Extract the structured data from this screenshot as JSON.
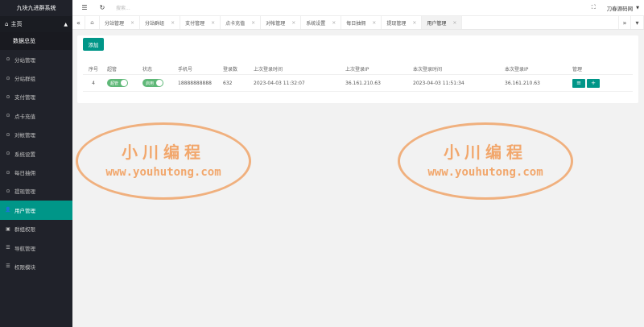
{
  "app_title": "九块九进群系统",
  "sidebar": {
    "home_label": "主页",
    "home_sub": "数据总览",
    "items": [
      {
        "label": "分站管理",
        "icon": "circle-check-icon"
      },
      {
        "label": "分站群组",
        "icon": "circle-check-icon"
      },
      {
        "label": "支付管理",
        "icon": "circle-check-icon"
      },
      {
        "label": "点卡充值",
        "icon": "circle-check-icon"
      },
      {
        "label": "对帐管理",
        "icon": "circle-check-icon"
      },
      {
        "label": "系统设置",
        "icon": "circle-check-icon"
      },
      {
        "label": "每日抽佣",
        "icon": "circle-check-icon"
      },
      {
        "label": "提现管理",
        "icon": "circle-check-icon"
      },
      {
        "label": "用户管理",
        "icon": "user-icon",
        "active": true
      },
      {
        "label": "群组权限",
        "icon": "group-icon"
      },
      {
        "label": "导航管理",
        "icon": "list-icon"
      },
      {
        "label": "权限模块",
        "icon": "list-icon"
      }
    ]
  },
  "topbar": {
    "search_placeholder": "搜索...",
    "username": "刀春源码网"
  },
  "tabs": [
    {
      "label": "分站管理"
    },
    {
      "label": "分站群组"
    },
    {
      "label": "支付管理"
    },
    {
      "label": "点卡充值"
    },
    {
      "label": "对帐管理"
    },
    {
      "label": "系统设置"
    },
    {
      "label": "每日抽佣"
    },
    {
      "label": "提现管理"
    },
    {
      "label": "用户管理",
      "active": true
    }
  ],
  "main": {
    "add_label": "添加",
    "columns": [
      "序号",
      "超管",
      "状态",
      "手机号",
      "登录数",
      "上次登录时间",
      "上次登录IP",
      "本次登录时间",
      "本次登录IP",
      "管理"
    ],
    "rows": [
      {
        "index": "4",
        "admin_switch": "超管",
        "status_switch": "启用",
        "phone": "18888888888",
        "login_count": "632",
        "last_login_time": "2023-04-03 11:32:07",
        "last_login_ip": "36.161.210.63",
        "current_login_time": "2023-04-03 11:51:34",
        "current_login_ip": "36.161.210.63",
        "edit_label": "≡",
        "add_label": "+"
      }
    ]
  },
  "watermarks": [
    {
      "title": "小川编程",
      "url": "www.youhutong.com"
    },
    {
      "title": "小川编程",
      "url": "www.youhutong.com"
    }
  ],
  "colors": {
    "sidebar_bg": "#20222a",
    "accent": "#009688",
    "switch_on": "#5fb878",
    "watermark": "#f29a55"
  }
}
